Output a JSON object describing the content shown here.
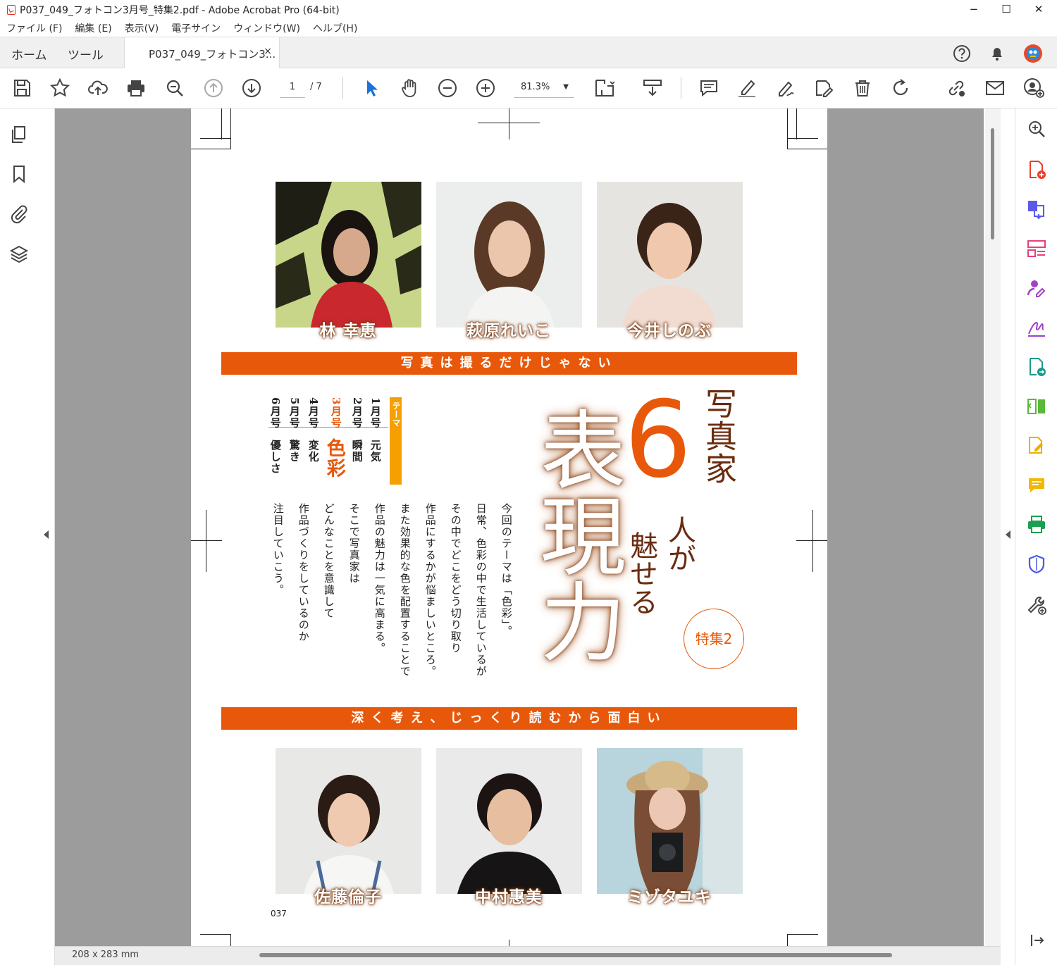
{
  "window": {
    "title": "P037_049_フォトコン3月号_特集2.pdf - Adobe Acrobat Pro (64-bit)",
    "minimize": "−",
    "maximize": "☐",
    "close": "✕"
  },
  "menu": [
    "ファイル (F)",
    "編集 (E)",
    "表示(V)",
    "電子サイン",
    "ウィンドウ(W)",
    "ヘルプ(H)"
  ],
  "tabs": {
    "home": "ホーム",
    "tools": "ツール",
    "doc": "P037_049_フォトコン3...",
    "doc_close": "×"
  },
  "toolbar": {
    "page_current": "1",
    "page_total": "/ 7",
    "zoom": "81.3%",
    "zoom_caret": "▼"
  },
  "status": {
    "dimensions": "208 x 283 mm"
  },
  "colors": {
    "accent": "#e8580a",
    "brown": "#5a2a0a",
    "highlight": "#f5a000"
  },
  "document": {
    "page_number": "037",
    "top_band": "写真は撮るだけじゃない",
    "bottom_band": "深く考え、じっくり読むから面白い",
    "title_vertical": "写真家",
    "title_number": "6",
    "title_sub1": "人が",
    "title_sub2": "魅せる",
    "title_main": "表現力",
    "badge": "特集2",
    "theme_label": "テーマ",
    "themes": [
      {
        "month": "1月号",
        "theme": "元気"
      },
      {
        "month": "2月号",
        "theme": "瞬間"
      },
      {
        "month": "3月号",
        "theme": "色彩"
      },
      {
        "month": "4月号",
        "theme": "変化"
      },
      {
        "month": "5月号",
        "theme": "驚き"
      },
      {
        "month": "6月号",
        "theme": "優しさ"
      }
    ],
    "intro_lines": [
      "今回のテーマは「色彩」。",
      "日常、色彩の中で生活しているが",
      "その中でどこをどう切り取り",
      "作品にするかが悩ましいところ。",
      "また効果的な色を配置することで",
      "作品の魅力は一気に高まる。",
      "そこで写真家は",
      "どんなことを意識して",
      "作品づくりをしているのか",
      "注目していこう。"
    ],
    "photographers_top": [
      "林 幸恵",
      "萩原れいこ",
      "今井しのぶ"
    ],
    "photographers_bottom": [
      "佐藤倫子",
      "中村惠美",
      "ミゾタユキ"
    ]
  }
}
